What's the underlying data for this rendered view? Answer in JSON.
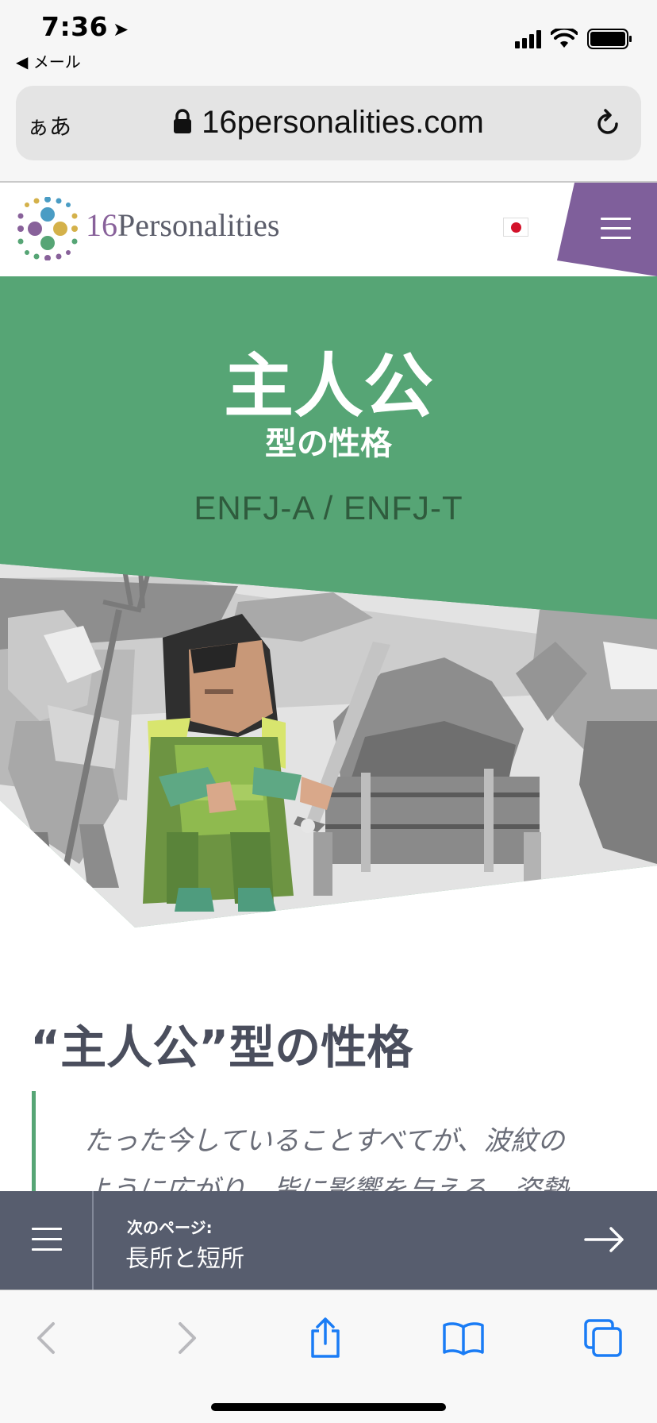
{
  "status_bar": {
    "time": "7:36",
    "location_glyph": "➤",
    "back_label": "◀ メール"
  },
  "url_bar": {
    "text_size_label": "ぁあ",
    "domain": "16personalities.com"
  },
  "site_header": {
    "logo_number": "16",
    "logo_word": "Personalities",
    "flag": "japan-flag",
    "menu_color": "#7f5f9b"
  },
  "hero": {
    "title": "主人公",
    "subtitle": "型の性格",
    "codes": "ENFJ-A / ENFJ-T",
    "background": "#56a575"
  },
  "article": {
    "heading": "“主人公”型の性格",
    "quote_line1": "たった今していることすべてが、波紋の",
    "quote_line2": "ように広がり、皆に影響を与える。姿勢"
  },
  "next_page": {
    "label": "次のページ:",
    "title": "長所と短所"
  },
  "toolbar": {
    "accent": "#1a7cf5",
    "icons": [
      "back-arrow-icon",
      "forward-arrow-icon",
      "share-icon",
      "bookmarks-icon",
      "tabs-icon"
    ]
  }
}
